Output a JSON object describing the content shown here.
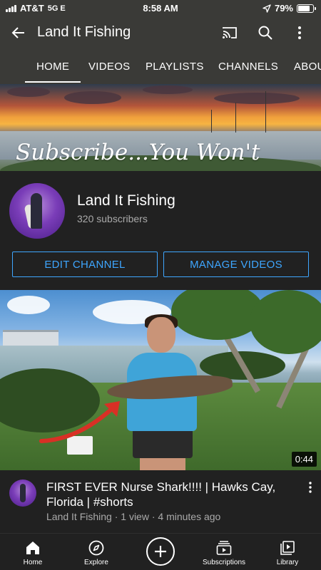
{
  "status_bar": {
    "carrier": "AT&T",
    "network": "5G E",
    "time": "8:58 AM",
    "battery": "79%",
    "battery_level": 0.79,
    "icons": [
      "signal-bars-icon",
      "location-arrow-icon",
      "battery-icon"
    ]
  },
  "app_bar": {
    "title": "Land It Fishing",
    "icons": [
      "back-arrow-icon",
      "cast-icon",
      "search-icon",
      "more-vert-icon"
    ]
  },
  "tabs": [
    {
      "label": "HOME",
      "active": true
    },
    {
      "label": "VIDEOS",
      "active": false
    },
    {
      "label": "PLAYLISTS",
      "active": false
    },
    {
      "label": "CHANNELS",
      "active": false
    },
    {
      "label": "ABOU",
      "active": false
    }
  ],
  "banner": {
    "text": "Subscribe...You Won't"
  },
  "channel": {
    "name": "Land It Fishing",
    "subscribers": "320 subscribers"
  },
  "buttons": {
    "edit": "EDIT CHANNEL",
    "manage": "MANAGE VIDEOS"
  },
  "video": {
    "duration": "0:44",
    "title": "FIRST EVER Nurse Shark!!!! | Hawks Cay, Florida | #shorts",
    "meta": "Land It Fishing · 1 view · 4 minutes ago"
  },
  "bottom_nav": [
    {
      "label": "Home",
      "icon": "home-icon",
      "active": true
    },
    {
      "label": "Explore",
      "icon": "compass-icon",
      "active": false
    },
    {
      "label": "",
      "icon": "create-plus-icon",
      "active": false
    },
    {
      "label": "Subscriptions",
      "icon": "subscriptions-icon",
      "active": false
    },
    {
      "label": "Library",
      "icon": "library-icon",
      "active": false
    }
  ],
  "colors": {
    "app_bar": "#3a3a37",
    "background": "#212121",
    "accent_blue": "#3ea6ff",
    "secondary_text": "#aaaaaa"
  }
}
